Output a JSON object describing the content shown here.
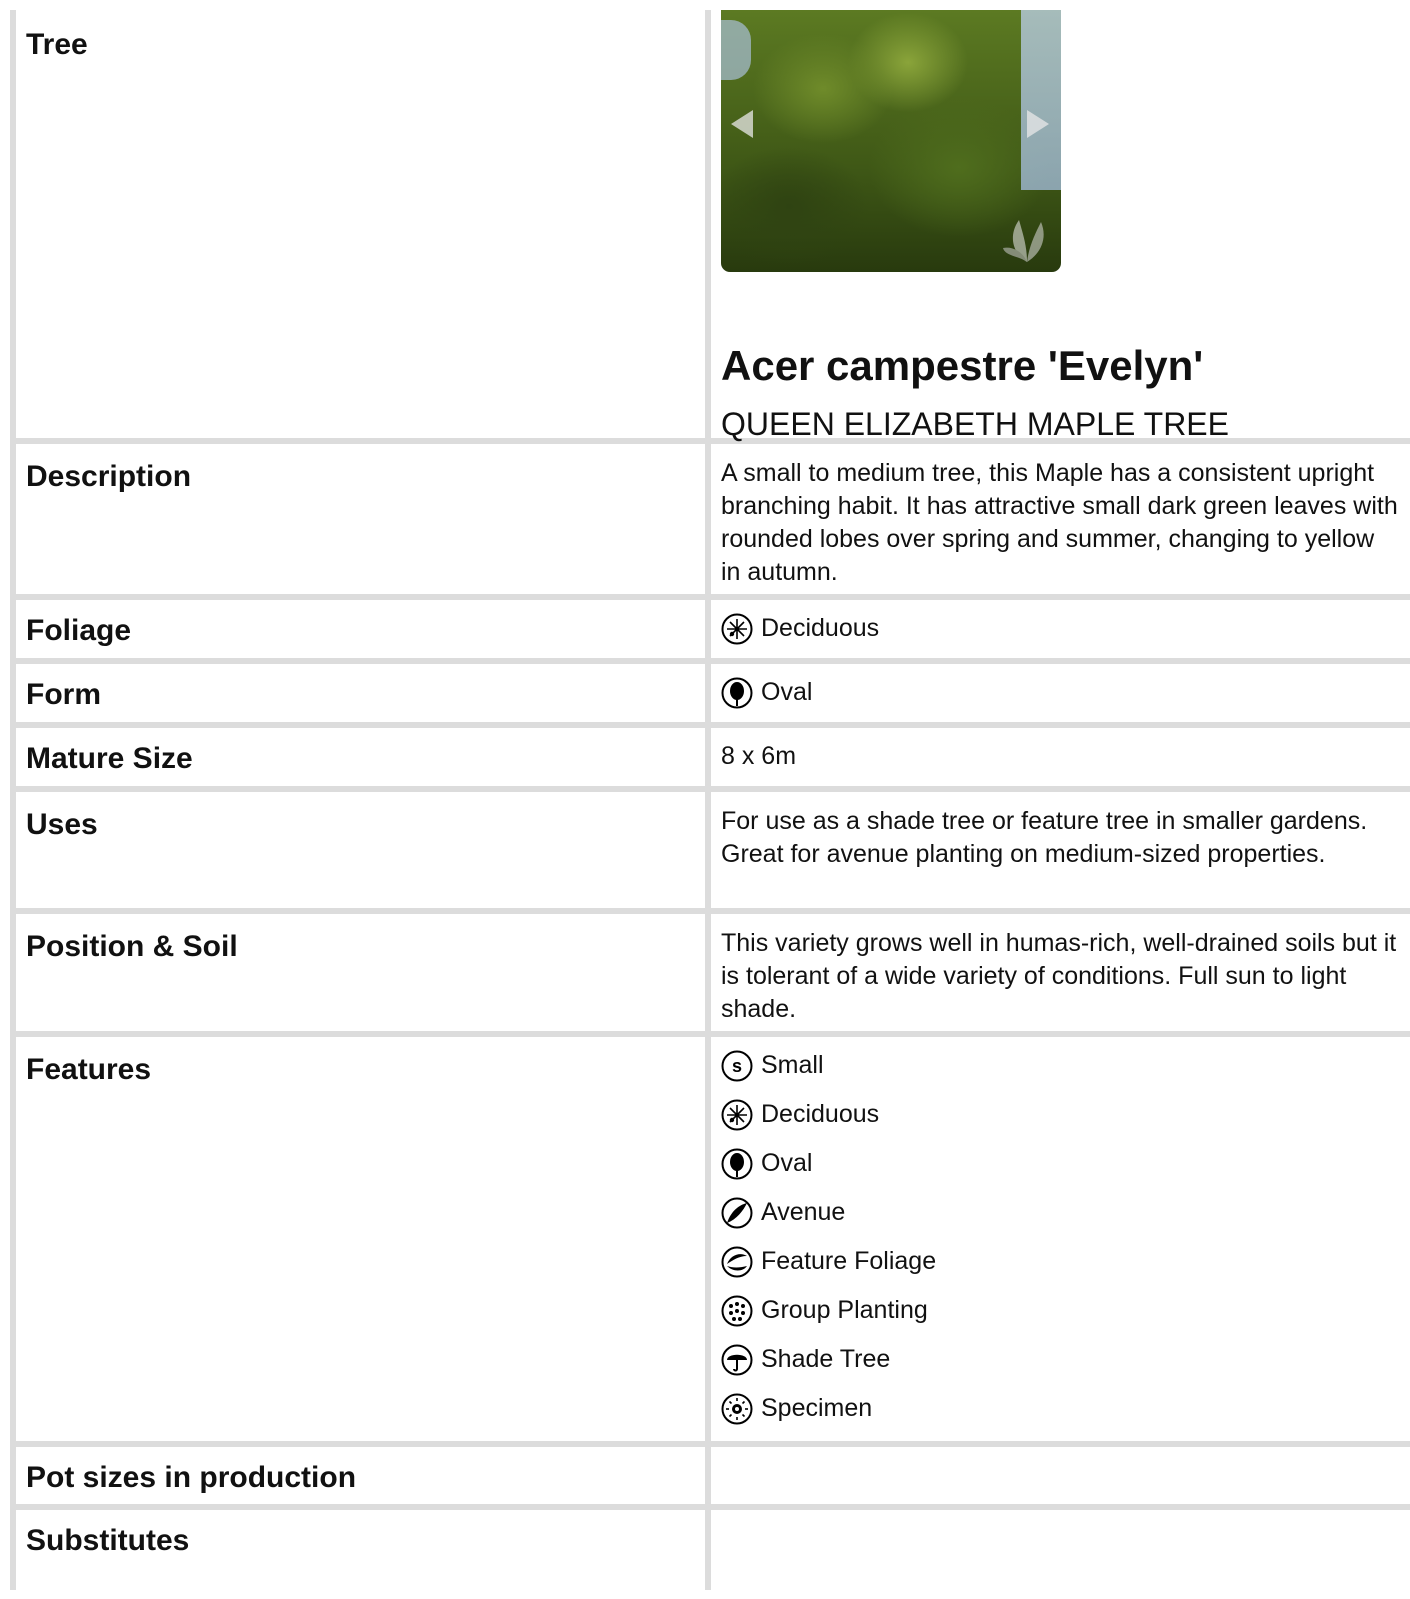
{
  "rows": {
    "tree": {
      "label": "Tree",
      "plant_name": "Acer campestre 'Evelyn'",
      "common_name": "QUEEN ELIZABETH MAPLE TREE"
    },
    "description": {
      "label": "Description",
      "text": "A small to medium tree, this Maple has a consistent upright branching habit. It has attractive small dark green leaves with rounded lobes over spring and summer, changing to yellow in autumn."
    },
    "foliage": {
      "label": "Foliage",
      "value": "Deciduous",
      "icon": "deciduous-icon"
    },
    "form": {
      "label": "Form",
      "value": "Oval",
      "icon": "oval-icon"
    },
    "mature_size": {
      "label": "Mature Size",
      "value": "8 x 6m"
    },
    "uses": {
      "label": "Uses",
      "text": "For use as a shade tree or feature tree in smaller gardens. Great for avenue planting on medium-sized properties."
    },
    "position_soil": {
      "label": "Position & Soil",
      "text": "This variety grows well in humas-rich, well-drained soils but it is tolerant of a wide variety of conditions. Full sun to light shade."
    },
    "features": {
      "label": "Features",
      "items": [
        {
          "name": "Small",
          "icon": "small-icon"
        },
        {
          "name": "Deciduous",
          "icon": "deciduous-icon"
        },
        {
          "name": "Oval",
          "icon": "oval-icon"
        },
        {
          "name": "Avenue",
          "icon": "avenue-icon"
        },
        {
          "name": "Feature Foliage",
          "icon": "feature-foliage-icon"
        },
        {
          "name": "Group Planting",
          "icon": "group-planting-icon"
        },
        {
          "name": "Shade Tree",
          "icon": "shade-tree-icon"
        },
        {
          "name": "Specimen",
          "icon": "specimen-icon"
        }
      ]
    },
    "pot_sizes": {
      "label": "Pot sizes in production",
      "value": ""
    },
    "substitutes": {
      "label": "Substitutes",
      "value": ""
    }
  }
}
